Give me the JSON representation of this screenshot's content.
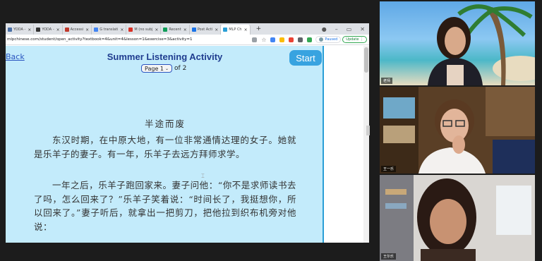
{
  "tabs": [
    {
      "label": "YODA -",
      "color": "#4a6fa5"
    },
    {
      "label": "YODA -",
      "color": "#333333"
    },
    {
      "label": "Accessi",
      "color": "#c0392b"
    },
    {
      "label": "G translati",
      "color": "#4285f4"
    },
    {
      "label": "M (no subj",
      "color": "#d93025"
    },
    {
      "label": "Recent",
      "color": "#0f9d58"
    },
    {
      "label": "Post Acti",
      "color": "#1a73e8"
    },
    {
      "label": "MLP Ch",
      "color": "#2a9fd6"
    }
  ],
  "browser": {
    "url": "mlpchinese.com/student/open_activity?textbook=4&unit=4&lesson=1&exercise=3&activity=1",
    "paused_label": "Paused",
    "update_label": "Update"
  },
  "activity": {
    "back_label": "Back",
    "title": "Summer Listening Activity",
    "page_label": "Page 1",
    "of_label": "of 2",
    "start_label": "Start",
    "story_title": "半途而废",
    "paragraph1": "东汉时期，在中原大地，有一位非常通情达理的女子。她就是乐羊子的妻子。有一年，乐羊子去远方拜师求学。",
    "paragraph2": "一年之后，乐羊子跑回家来。妻子问他：“你不是求师读书去了吗，怎么回来了？”乐羊子笑着说：“时间长了，我挺想你，所以回来了。”妻子听后，就拿出一把剪刀，把他拉到织布机旁对他说："
  },
  "participants": [
    {
      "name": "老师"
    },
    {
      "name": "王一乐"
    },
    {
      "name": "王尔乐"
    }
  ]
}
